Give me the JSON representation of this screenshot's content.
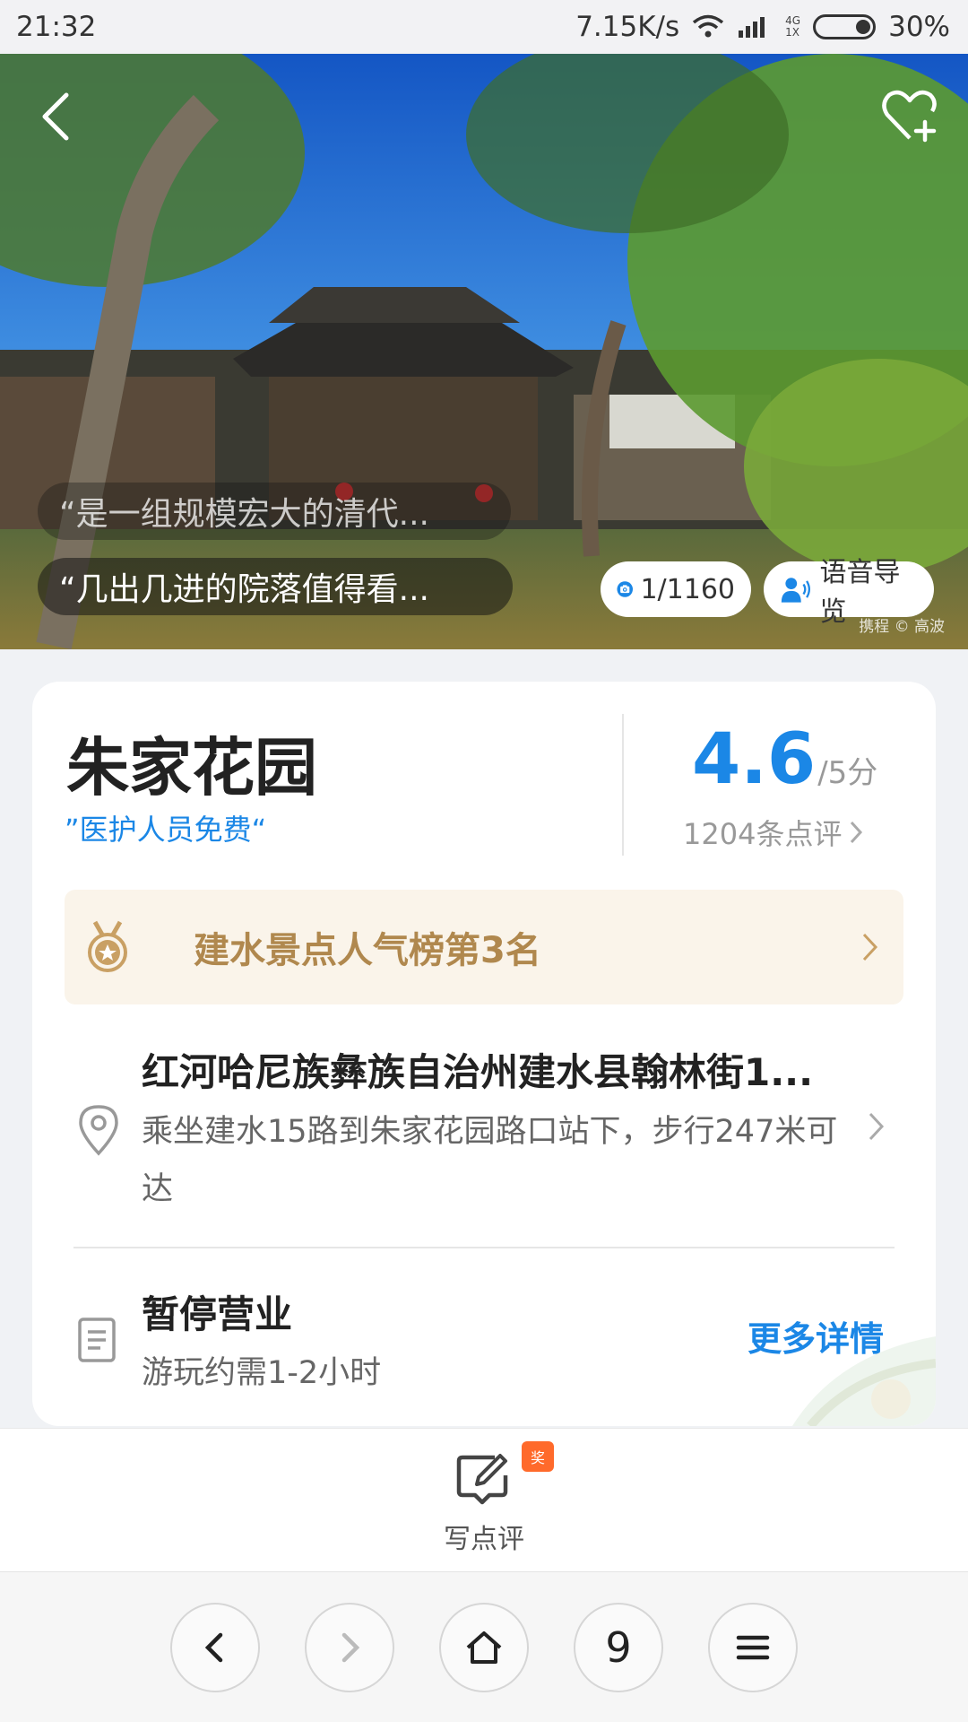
{
  "status_bar": {
    "time": "21:32",
    "speed": "7.15K/s",
    "network_top": "4G",
    "network_bottom": "1X",
    "battery": "30%"
  },
  "hero": {
    "quotes": [
      "“是一组规模宏大的清代...",
      "“几出几进的院落值得看..."
    ],
    "photo_count": "1/1160",
    "audio_guide": "语音导览",
    "credit": "携程 © 高波"
  },
  "poi": {
    "name": "朱家花园",
    "tag": "”医护人员免费“",
    "score": "4.6",
    "score_unit": "/5分",
    "reviews": "1204条点评"
  },
  "ranking": {
    "label": "建水景点人气榜第3名"
  },
  "address": {
    "title": "红河哈尼族彝族自治州建水县翰林街1...",
    "directions": "乘坐建水15路到朱家花园路口站下，步行247米可达"
  },
  "hours": {
    "status": "暂停营业",
    "duration": "游玩约需1-2小时",
    "more": "更多详情"
  },
  "action_bar": {
    "write_review": "写点评",
    "badge": "奖"
  },
  "browser_nav": {
    "tabs_count": "9"
  },
  "colors": {
    "accent": "#1b87e6",
    "rank_text": "#b0884e",
    "rank_bg": "#faf4ea",
    "badge": "#ff6a2b"
  }
}
